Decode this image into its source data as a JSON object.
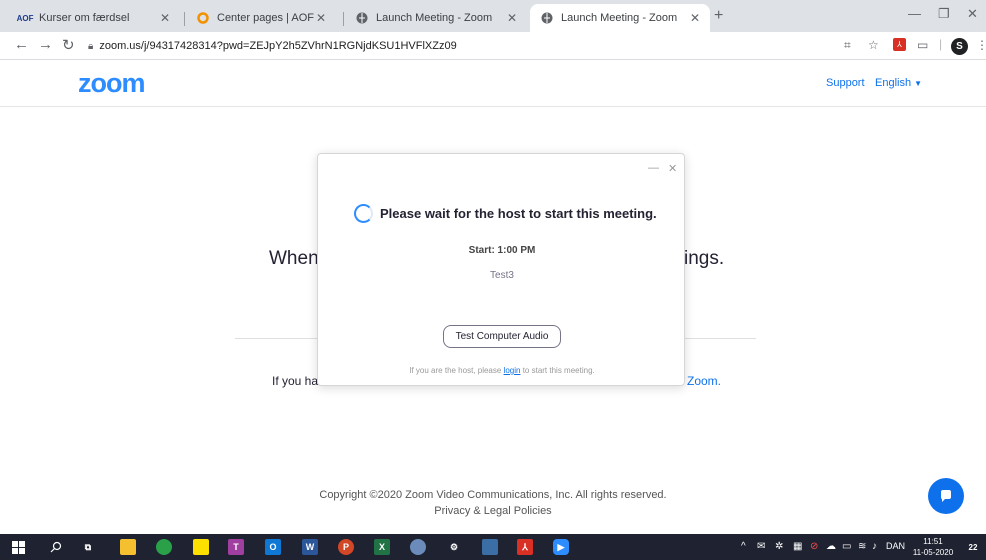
{
  "browser": {
    "tabs": [
      {
        "label": "Kurser om færdsel",
        "favicon": "aof-logo-icon",
        "active": false
      },
      {
        "label": "Center pages | AOF",
        "favicon": "circle-orange-icon",
        "active": false
      },
      {
        "label": "Launch Meeting - Zoom",
        "favicon": "globe-icon",
        "active": false
      },
      {
        "label": "Launch Meeting - Zoom",
        "favicon": "globe-icon",
        "active": true
      }
    ],
    "url": "zoom.us/j/94317428314?pwd=ZEJpY2h5ZVhrN1RGNjdKSU1HVFlXZz09",
    "profile_initial": "S"
  },
  "zoom_header": {
    "logo": "zoom",
    "support": "Support",
    "language": "English"
  },
  "page": {
    "heading_left": "When",
    "heading_right": "ings.",
    "line_left": "If you hav",
    "line_right": "Zoom.",
    "copyright": "Copyright ©2020 Zoom Video Communications, Inc. All rights reserved.",
    "privacy": "Privacy & Legal Policies"
  },
  "dialog": {
    "title": "Please wait for the host to start this meeting.",
    "start": "Start: 1:00 PM",
    "topic": "Test3",
    "button": "Test Computer Audio",
    "note_pre": "If you are the host, please",
    "note_link": "login",
    "note_post": "to start this meeting."
  },
  "taskbar": {
    "language": "DAN",
    "time": "11:51",
    "date": "11-05-2020",
    "notifications": "22"
  },
  "colors": {
    "zoom_blue": "#2d8cff",
    "link_blue": "#0e71eb",
    "taskbar": "#1f2230"
  }
}
